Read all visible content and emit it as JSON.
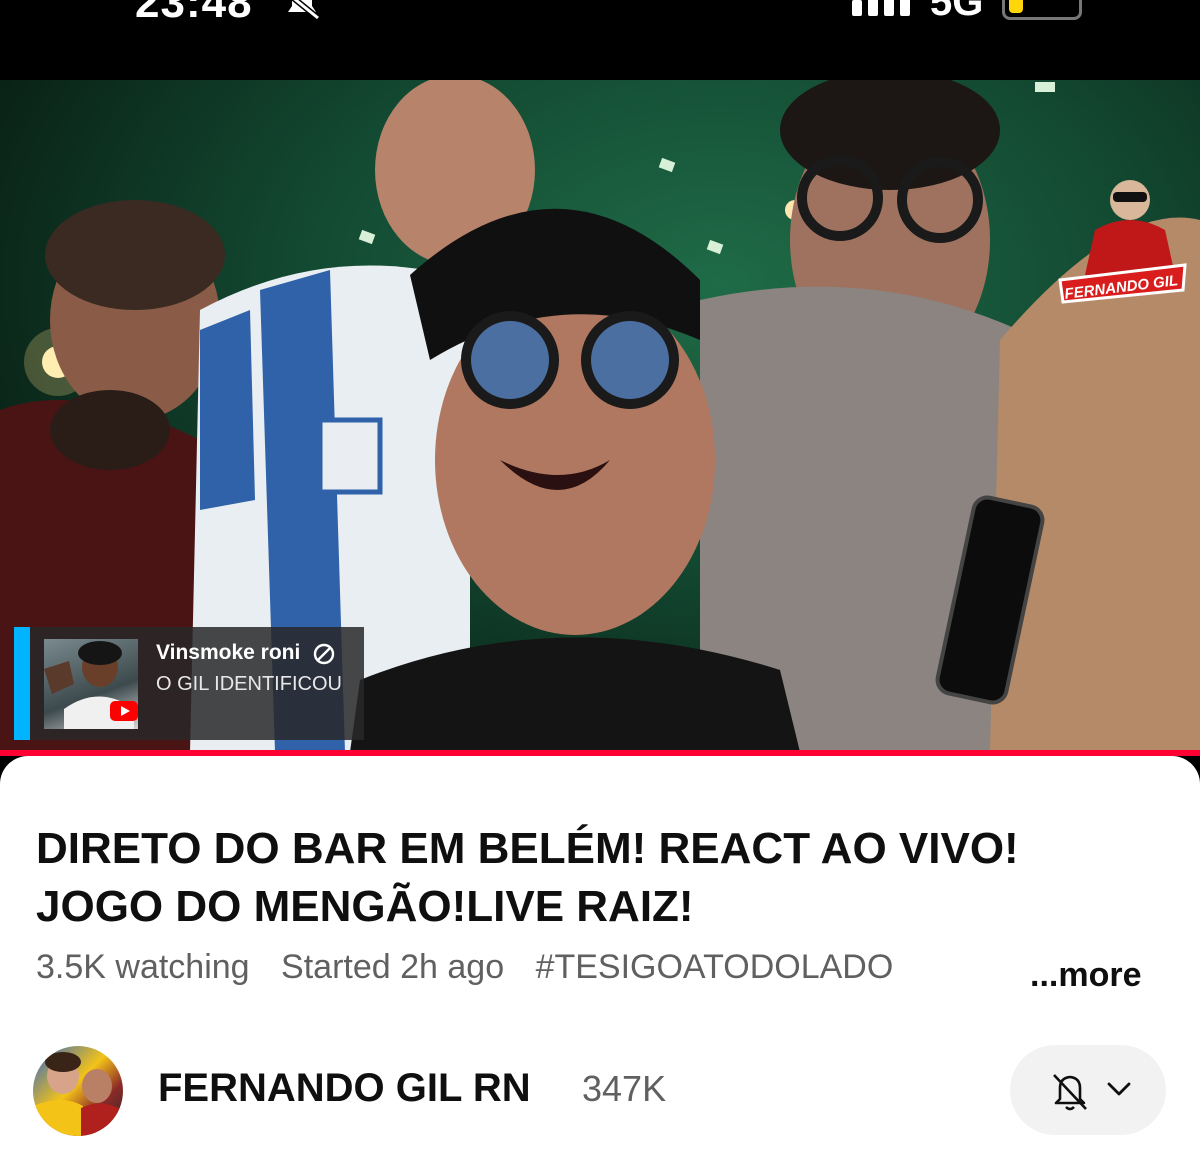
{
  "status_bar": {
    "time": "23:48",
    "network": "5G",
    "icons": [
      "bell-off-icon",
      "signal-icon",
      "battery-icon"
    ],
    "battery_color": "#ffd60a"
  },
  "video": {
    "live_chat": {
      "author": "Vinsmoke roni",
      "message": "O GIL IDENTIFICOU",
      "accent_color": "#00b4ff"
    },
    "channel_logo_text": "FERNANDO GIL",
    "progress_color": "#ff0033"
  },
  "details": {
    "title": "DIRETO DO BAR EM BELÉM! REACT AO VIVO! JOGO DO MENGÃO!LIVE RAIZ!",
    "watching": "3.5K watching",
    "started": "Started 2h ago",
    "hashtag": "#TESIGOATODOLADO",
    "more_label": "...more"
  },
  "channel": {
    "name": "FERNANDO GIL RN",
    "subscribers": "347K",
    "notification_icon": "bell-off-icon"
  }
}
